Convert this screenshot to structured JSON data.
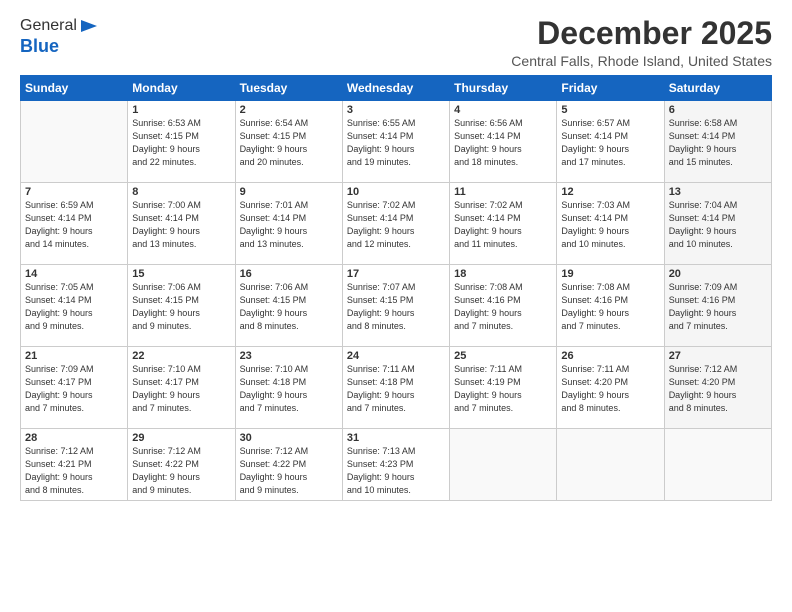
{
  "header": {
    "logo_general": "General",
    "logo_blue": "Blue",
    "month_title": "December 2025",
    "location": "Central Falls, Rhode Island, United States"
  },
  "weekdays": [
    "Sunday",
    "Monday",
    "Tuesday",
    "Wednesday",
    "Thursday",
    "Friday",
    "Saturday"
  ],
  "weeks": [
    [
      {
        "day": "",
        "info": ""
      },
      {
        "day": "1",
        "info": "Sunrise: 6:53 AM\nSunset: 4:15 PM\nDaylight: 9 hours\nand 22 minutes."
      },
      {
        "day": "2",
        "info": "Sunrise: 6:54 AM\nSunset: 4:15 PM\nDaylight: 9 hours\nand 20 minutes."
      },
      {
        "day": "3",
        "info": "Sunrise: 6:55 AM\nSunset: 4:14 PM\nDaylight: 9 hours\nand 19 minutes."
      },
      {
        "day": "4",
        "info": "Sunrise: 6:56 AM\nSunset: 4:14 PM\nDaylight: 9 hours\nand 18 minutes."
      },
      {
        "day": "5",
        "info": "Sunrise: 6:57 AM\nSunset: 4:14 PM\nDaylight: 9 hours\nand 17 minutes."
      },
      {
        "day": "6",
        "info": "Sunrise: 6:58 AM\nSunset: 4:14 PM\nDaylight: 9 hours\nand 15 minutes."
      }
    ],
    [
      {
        "day": "7",
        "info": "Sunrise: 6:59 AM\nSunset: 4:14 PM\nDaylight: 9 hours\nand 14 minutes."
      },
      {
        "day": "8",
        "info": "Sunrise: 7:00 AM\nSunset: 4:14 PM\nDaylight: 9 hours\nand 13 minutes."
      },
      {
        "day": "9",
        "info": "Sunrise: 7:01 AM\nSunset: 4:14 PM\nDaylight: 9 hours\nand 13 minutes."
      },
      {
        "day": "10",
        "info": "Sunrise: 7:02 AM\nSunset: 4:14 PM\nDaylight: 9 hours\nand 12 minutes."
      },
      {
        "day": "11",
        "info": "Sunrise: 7:02 AM\nSunset: 4:14 PM\nDaylight: 9 hours\nand 11 minutes."
      },
      {
        "day": "12",
        "info": "Sunrise: 7:03 AM\nSunset: 4:14 PM\nDaylight: 9 hours\nand 10 minutes."
      },
      {
        "day": "13",
        "info": "Sunrise: 7:04 AM\nSunset: 4:14 PM\nDaylight: 9 hours\nand 10 minutes."
      }
    ],
    [
      {
        "day": "14",
        "info": "Sunrise: 7:05 AM\nSunset: 4:14 PM\nDaylight: 9 hours\nand 9 minutes."
      },
      {
        "day": "15",
        "info": "Sunrise: 7:06 AM\nSunset: 4:15 PM\nDaylight: 9 hours\nand 9 minutes."
      },
      {
        "day": "16",
        "info": "Sunrise: 7:06 AM\nSunset: 4:15 PM\nDaylight: 9 hours\nand 8 minutes."
      },
      {
        "day": "17",
        "info": "Sunrise: 7:07 AM\nSunset: 4:15 PM\nDaylight: 9 hours\nand 8 minutes."
      },
      {
        "day": "18",
        "info": "Sunrise: 7:08 AM\nSunset: 4:16 PM\nDaylight: 9 hours\nand 7 minutes."
      },
      {
        "day": "19",
        "info": "Sunrise: 7:08 AM\nSunset: 4:16 PM\nDaylight: 9 hours\nand 7 minutes."
      },
      {
        "day": "20",
        "info": "Sunrise: 7:09 AM\nSunset: 4:16 PM\nDaylight: 9 hours\nand 7 minutes."
      }
    ],
    [
      {
        "day": "21",
        "info": "Sunrise: 7:09 AM\nSunset: 4:17 PM\nDaylight: 9 hours\nand 7 minutes."
      },
      {
        "day": "22",
        "info": "Sunrise: 7:10 AM\nSunset: 4:17 PM\nDaylight: 9 hours\nand 7 minutes."
      },
      {
        "day": "23",
        "info": "Sunrise: 7:10 AM\nSunset: 4:18 PM\nDaylight: 9 hours\nand 7 minutes."
      },
      {
        "day": "24",
        "info": "Sunrise: 7:11 AM\nSunset: 4:18 PM\nDaylight: 9 hours\nand 7 minutes."
      },
      {
        "day": "25",
        "info": "Sunrise: 7:11 AM\nSunset: 4:19 PM\nDaylight: 9 hours\nand 7 minutes."
      },
      {
        "day": "26",
        "info": "Sunrise: 7:11 AM\nSunset: 4:20 PM\nDaylight: 9 hours\nand 8 minutes."
      },
      {
        "day": "27",
        "info": "Sunrise: 7:12 AM\nSunset: 4:20 PM\nDaylight: 9 hours\nand 8 minutes."
      }
    ],
    [
      {
        "day": "28",
        "info": "Sunrise: 7:12 AM\nSunset: 4:21 PM\nDaylight: 9 hours\nand 8 minutes."
      },
      {
        "day": "29",
        "info": "Sunrise: 7:12 AM\nSunset: 4:22 PM\nDaylight: 9 hours\nand 9 minutes."
      },
      {
        "day": "30",
        "info": "Sunrise: 7:12 AM\nSunset: 4:22 PM\nDaylight: 9 hours\nand 9 minutes."
      },
      {
        "day": "31",
        "info": "Sunrise: 7:13 AM\nSunset: 4:23 PM\nDaylight: 9 hours\nand 10 minutes."
      },
      {
        "day": "",
        "info": ""
      },
      {
        "day": "",
        "info": ""
      },
      {
        "day": "",
        "info": ""
      }
    ]
  ]
}
